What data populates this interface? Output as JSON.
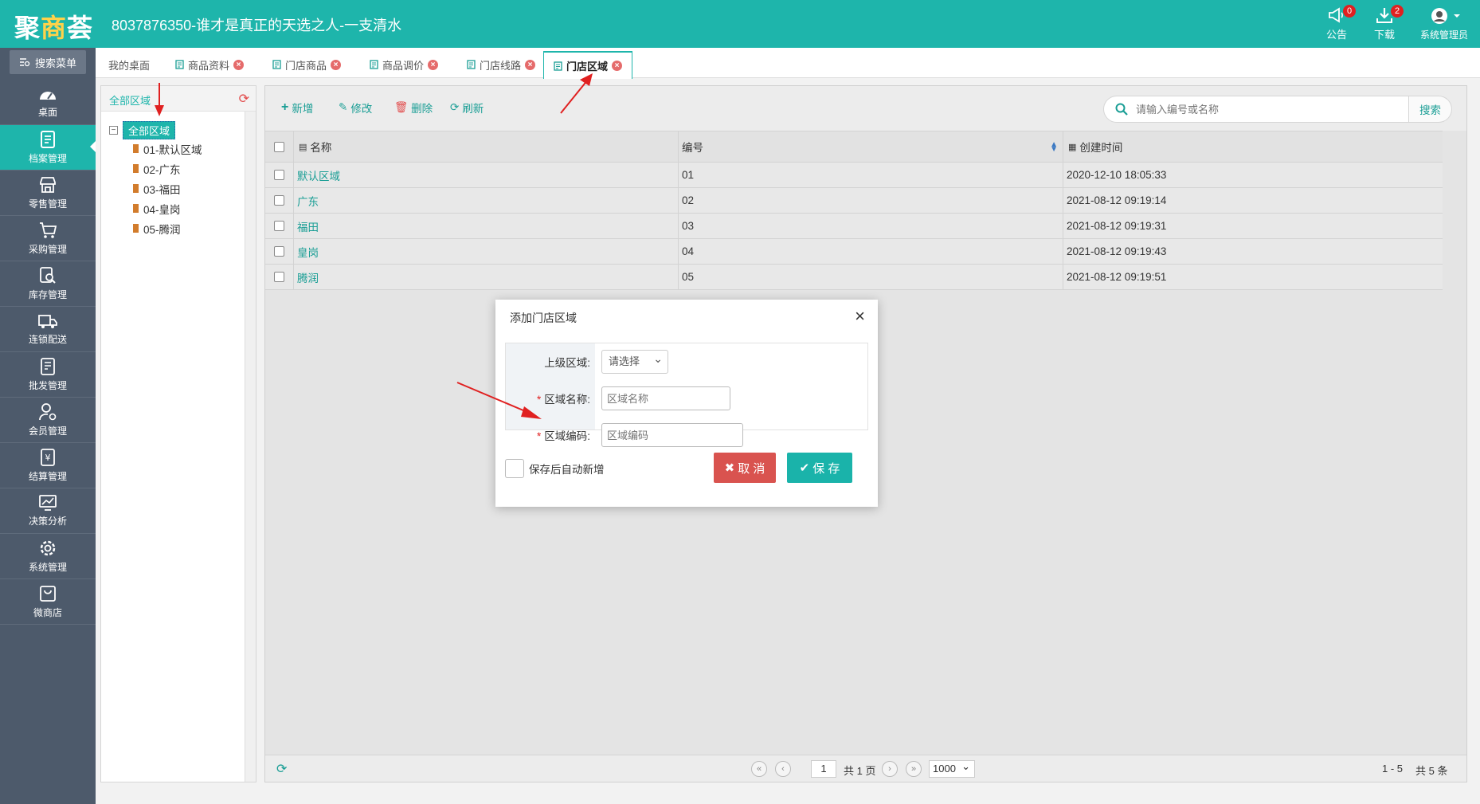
{
  "app": {
    "logo_main": "聚",
    "logo_accent": "商",
    "logo_tail": "荟",
    "title": "8037876350-谁才是真正的天选之人-一支清水"
  },
  "top_tools": {
    "notice_label": "公告",
    "notice_count": "0",
    "download_label": "下载",
    "download_count": "2",
    "user_label": "系统管理员"
  },
  "sidebar": {
    "search_label": "搜索菜单",
    "items": [
      {
        "label": "桌面",
        "icon": "dashboard-icon"
      },
      {
        "label": "档案管理",
        "icon": "archive-icon",
        "active": true
      },
      {
        "label": "零售管理",
        "icon": "store-icon"
      },
      {
        "label": "采购管理",
        "icon": "cart-icon"
      },
      {
        "label": "库存管理",
        "icon": "inventory-search-icon"
      },
      {
        "label": "连锁配送",
        "icon": "truck-icon"
      },
      {
        "label": "批发管理",
        "icon": "wholesale-icon"
      },
      {
        "label": "会员管理",
        "icon": "member-icon"
      },
      {
        "label": "结算管理",
        "icon": "settlement-icon"
      },
      {
        "label": "决策分析",
        "icon": "chart-icon"
      },
      {
        "label": "系统管理",
        "icon": "gear-icon"
      },
      {
        "label": "微商店",
        "icon": "shop-bag-icon"
      }
    ]
  },
  "tabs": [
    {
      "label": "我的桌面"
    },
    {
      "label": "商品资料"
    },
    {
      "label": "门店商品"
    },
    {
      "label": "商品调价"
    },
    {
      "label": "门店线路"
    },
    {
      "label": "门店区域"
    }
  ],
  "tree": {
    "header": "全部区域",
    "root": "全部区域",
    "expander": "⊟",
    "children": [
      "01-默认区域",
      "02-广东",
      "03-福田",
      "04-皇岗",
      "05-腾润"
    ]
  },
  "toolbar": {
    "add": "新增",
    "edit": "修改",
    "delete": "删除",
    "refresh": "刷新",
    "search_placeholder": "请输入编号或名称",
    "search_button": "搜索"
  },
  "grid": {
    "columns": [
      "名称",
      "编号",
      "创建时间"
    ],
    "rows": [
      {
        "name": "默认区域",
        "code": "01",
        "created": "2020-12-10 18:05:33"
      },
      {
        "name": "广东",
        "code": "02",
        "created": "2021-08-12 09:19:14"
      },
      {
        "name": "福田",
        "code": "03",
        "created": "2021-08-12 09:19:31"
      },
      {
        "name": "皇岗",
        "code": "04",
        "created": "2021-08-12 09:19:43"
      },
      {
        "name": "腾润",
        "code": "05",
        "created": "2021-08-12 09:19:51"
      }
    ]
  },
  "pager": {
    "current_page": "1",
    "total_pages": "共 1 页",
    "page_size": "1000",
    "range": "1 - 5",
    "total": "共 5 条"
  },
  "modal": {
    "title": "添加门店区域",
    "parent_label": "上级区域:",
    "parent_value": "请选择",
    "name_label": "区域名称:",
    "name_placeholder": "区域名称",
    "code_label": "区域编码:",
    "code_placeholder": "区域编码",
    "required_mark": "*",
    "auto_add_label": "保存后自动新增",
    "cancel": "取 消",
    "save": "保 存"
  }
}
